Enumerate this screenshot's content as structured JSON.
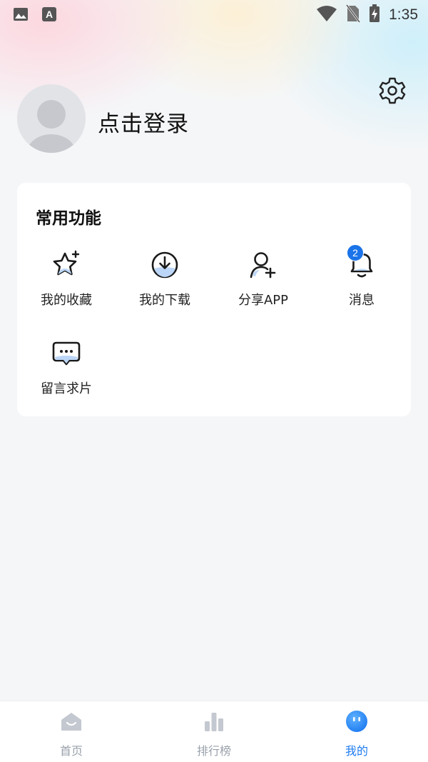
{
  "status_bar": {
    "time": "1:35",
    "icons": [
      "image-icon",
      "a-notification-icon",
      "wifi-icon",
      "no-sim-icon",
      "battery-charging-icon"
    ]
  },
  "profile": {
    "login_text": "点击登录",
    "avatar_icon": "default-avatar-icon",
    "settings_icon": "gear-icon"
  },
  "common_functions": {
    "title": "常用功能",
    "items": [
      {
        "label": "我的收藏",
        "icon": "star-favorite-icon"
      },
      {
        "label": "我的下载",
        "icon": "download-icon"
      },
      {
        "label": "分享APP",
        "icon": "add-user-icon"
      },
      {
        "label": "消息",
        "icon": "bell-icon",
        "badge": "2"
      },
      {
        "label": "留言求片",
        "icon": "message-bubble-icon"
      }
    ]
  },
  "tabbar": {
    "items": [
      {
        "label": "首页",
        "icon": "home-icon",
        "active": false
      },
      {
        "label": "排行榜",
        "icon": "bar-chart-icon",
        "active": false
      },
      {
        "label": "我的",
        "icon": "smiley-face-icon",
        "active": true
      }
    ]
  },
  "colors": {
    "accent": "#1e7bf0",
    "badge": "#1a73e8",
    "tab_inactive": "#9aa1ab"
  }
}
